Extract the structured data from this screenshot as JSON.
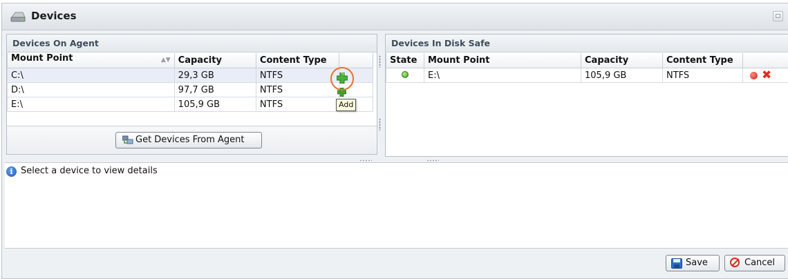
{
  "window": {
    "title": "Devices"
  },
  "agent": {
    "header": "Devices On Agent",
    "columns": [
      "Mount Point",
      "Capacity",
      "Content Type"
    ],
    "rows": [
      {
        "mount": "C:\\",
        "capacity": "29,3 GB",
        "type": "NTFS"
      },
      {
        "mount": "D:\\",
        "capacity": "97,7 GB",
        "type": "NTFS"
      },
      {
        "mount": "E:\\",
        "capacity": "105,9 GB",
        "type": "NTFS"
      }
    ],
    "add_tooltip": "Add",
    "get_devices_label": "Get Devices From Agent"
  },
  "safe": {
    "header": "Devices In Disk Safe",
    "columns": [
      "State",
      "Mount Point",
      "Capacity",
      "Content Type"
    ],
    "rows": [
      {
        "state": "online",
        "mount": "E:\\",
        "capacity": "105,9 GB",
        "type": "NTFS"
      }
    ]
  },
  "details": {
    "message": "Select a device to view details"
  },
  "footer": {
    "save_label": "Save",
    "cancel_label": "Cancel"
  },
  "colors": {
    "highlight_ring": "#ea6f2c",
    "add_green": "#3fa532",
    "delete_red": "#d9311e"
  }
}
